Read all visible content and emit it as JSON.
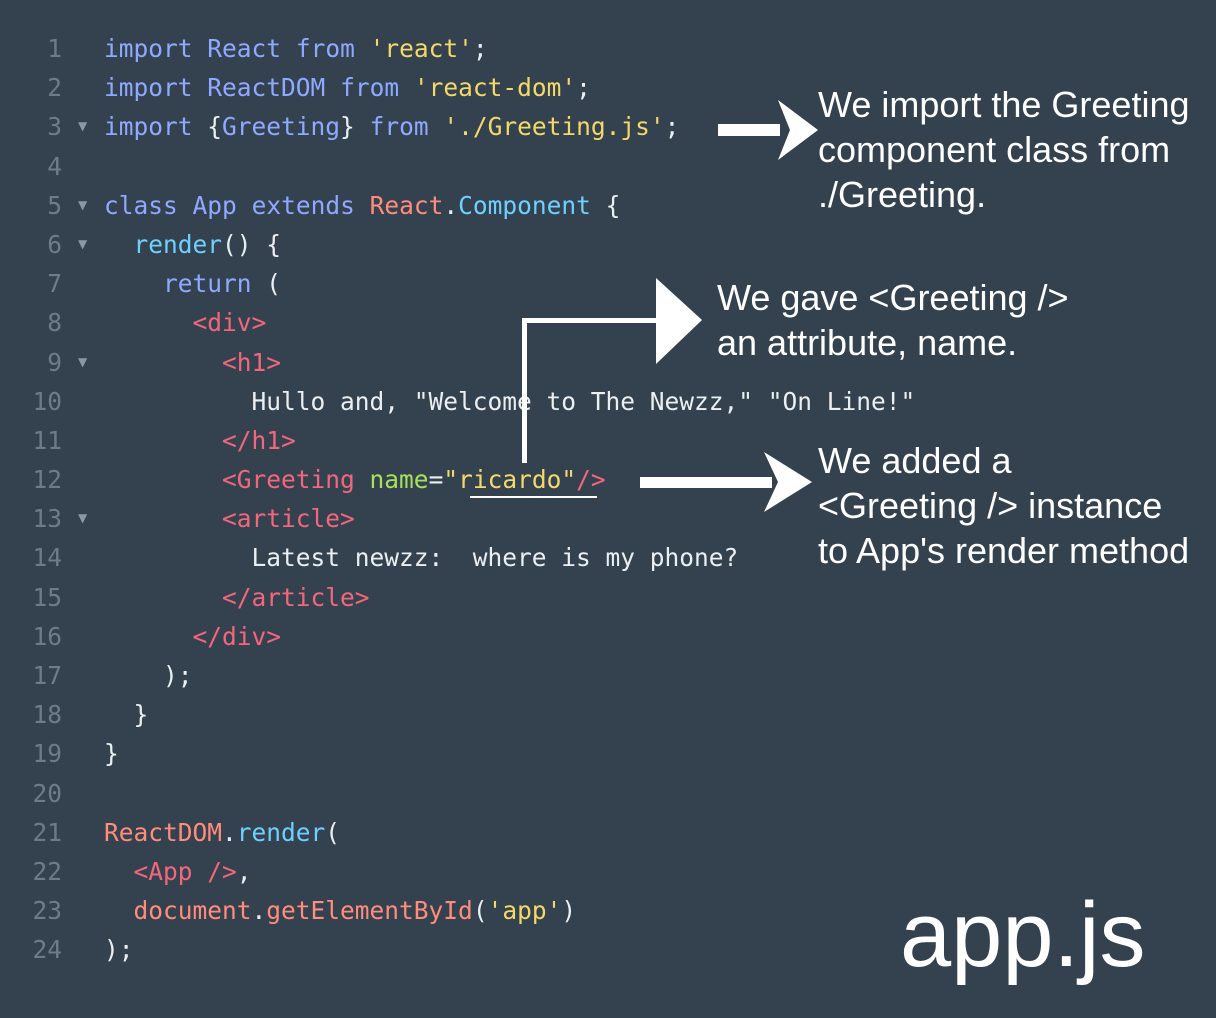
{
  "code_lines": [
    {
      "num": "1",
      "fold": "",
      "tokens": [
        {
          "t": "import",
          "c": "kw"
        },
        {
          "t": " ",
          "c": "text"
        },
        {
          "t": "React",
          "c": "kw"
        },
        {
          "t": " ",
          "c": "text"
        },
        {
          "t": "from",
          "c": "kw"
        },
        {
          "t": " ",
          "c": "text"
        },
        {
          "t": "'react'",
          "c": "str"
        },
        {
          "t": ";",
          "c": "punc"
        }
      ]
    },
    {
      "num": "2",
      "fold": "",
      "tokens": [
        {
          "t": "import",
          "c": "kw"
        },
        {
          "t": " ",
          "c": "text"
        },
        {
          "t": "ReactDOM",
          "c": "kw"
        },
        {
          "t": " ",
          "c": "text"
        },
        {
          "t": "from",
          "c": "kw"
        },
        {
          "t": " ",
          "c": "text"
        },
        {
          "t": "'react-dom'",
          "c": "str"
        },
        {
          "t": ";",
          "c": "punc"
        }
      ]
    },
    {
      "num": "3",
      "fold": "▼",
      "tokens": [
        {
          "t": "import",
          "c": "kw"
        },
        {
          "t": " {",
          "c": "punc"
        },
        {
          "t": "Greeting",
          "c": "kw"
        },
        {
          "t": "} ",
          "c": "punc"
        },
        {
          "t": "from",
          "c": "kw"
        },
        {
          "t": " ",
          "c": "text"
        },
        {
          "t": "'./Greeting.js'",
          "c": "str"
        },
        {
          "t": ";",
          "c": "punc"
        }
      ]
    },
    {
      "num": "4",
      "fold": "",
      "tokens": []
    },
    {
      "num": "5",
      "fold": "▼",
      "tokens": [
        {
          "t": "class",
          "c": "kw"
        },
        {
          "t": " ",
          "c": "text"
        },
        {
          "t": "App",
          "c": "kw"
        },
        {
          "t": " ",
          "c": "text"
        },
        {
          "t": "extends",
          "c": "kw"
        },
        {
          "t": " ",
          "c": "text"
        },
        {
          "t": "React",
          "c": "cls"
        },
        {
          "t": ".",
          "c": "punc"
        },
        {
          "t": "Component",
          "c": "method"
        },
        {
          "t": " {",
          "c": "punc"
        }
      ]
    },
    {
      "num": "6",
      "fold": "▼",
      "tokens": [
        {
          "t": "  ",
          "c": "text"
        },
        {
          "t": "render",
          "c": "method"
        },
        {
          "t": "() {",
          "c": "punc"
        }
      ]
    },
    {
      "num": "7",
      "fold": "",
      "tokens": [
        {
          "t": "    ",
          "c": "text"
        },
        {
          "t": "return",
          "c": "kw"
        },
        {
          "t": " (",
          "c": "punc"
        }
      ]
    },
    {
      "num": "8",
      "fold": "",
      "tokens": [
        {
          "t": "      ",
          "c": "text"
        },
        {
          "t": "<div>",
          "c": "tag"
        }
      ]
    },
    {
      "num": "9",
      "fold": "▼",
      "tokens": [
        {
          "t": "        ",
          "c": "text"
        },
        {
          "t": "<h1>",
          "c": "tag"
        }
      ]
    },
    {
      "num": "10",
      "fold": "",
      "tokens": [
        {
          "t": "          Hullo and, \"Welcome to The Newzz,\" \"On Line!\"",
          "c": "text"
        }
      ]
    },
    {
      "num": "11",
      "fold": "",
      "tokens": [
        {
          "t": "        ",
          "c": "text"
        },
        {
          "t": "</h1>",
          "c": "tag"
        }
      ]
    },
    {
      "num": "12",
      "fold": "",
      "tokens": [
        {
          "t": "        ",
          "c": "text"
        },
        {
          "t": "<Greeting",
          "c": "tag"
        },
        {
          "t": " ",
          "c": "text"
        },
        {
          "t": "name",
          "c": "attr"
        },
        {
          "t": "=",
          "c": "punc"
        },
        {
          "t": "\"ricardo\"",
          "c": "str"
        },
        {
          "t": "/>",
          "c": "tag"
        }
      ]
    },
    {
      "num": "13",
      "fold": "▼",
      "tokens": [
        {
          "t": "        ",
          "c": "text"
        },
        {
          "t": "<article>",
          "c": "tag"
        }
      ]
    },
    {
      "num": "14",
      "fold": "",
      "tokens": [
        {
          "t": "          Latest newzz:  where is my phone?",
          "c": "text"
        }
      ]
    },
    {
      "num": "15",
      "fold": "",
      "tokens": [
        {
          "t": "        ",
          "c": "text"
        },
        {
          "t": "</article>",
          "c": "tag"
        }
      ]
    },
    {
      "num": "16",
      "fold": "",
      "tokens": [
        {
          "t": "      ",
          "c": "text"
        },
        {
          "t": "</div>",
          "c": "tag"
        }
      ]
    },
    {
      "num": "17",
      "fold": "",
      "tokens": [
        {
          "t": "    );",
          "c": "punc"
        }
      ]
    },
    {
      "num": "18",
      "fold": "",
      "tokens": [
        {
          "t": "  }",
          "c": "punc"
        }
      ]
    },
    {
      "num": "19",
      "fold": "",
      "tokens": [
        {
          "t": "}",
          "c": "punc"
        }
      ]
    },
    {
      "num": "20",
      "fold": "",
      "tokens": []
    },
    {
      "num": "21",
      "fold": "",
      "tokens": [
        {
          "t": "ReactDOM",
          "c": "cls"
        },
        {
          "t": ".",
          "c": "punc"
        },
        {
          "t": "render",
          "c": "method"
        },
        {
          "t": "(",
          "c": "punc"
        }
      ]
    },
    {
      "num": "22",
      "fold": "",
      "tokens": [
        {
          "t": "  ",
          "c": "text"
        },
        {
          "t": "<App />",
          "c": "tag"
        },
        {
          "t": ",",
          "c": "punc"
        }
      ]
    },
    {
      "num": "23",
      "fold": "",
      "tokens": [
        {
          "t": "  ",
          "c": "text"
        },
        {
          "t": "document",
          "c": "cls"
        },
        {
          "t": ".",
          "c": "punc"
        },
        {
          "t": "getElementById",
          "c": "cls"
        },
        {
          "t": "(",
          "c": "punc"
        },
        {
          "t": "'app'",
          "c": "str"
        },
        {
          "t": ")",
          "c": "punc"
        }
      ]
    },
    {
      "num": "24",
      "fold": "",
      "tokens": [
        {
          "t": ");",
          "c": "punc"
        }
      ]
    }
  ],
  "annotations": {
    "import_note": "We import the Greeting\ncomponent class from\n./Greeting.",
    "attribute_note": "We gave <Greeting />\nan attribute, name.",
    "instance_note": "We added a\n<Greeting /> instance\nto App's render method"
  },
  "file_label": "app.js",
  "colors": {
    "background": "#34424f",
    "keyword": "#8ea9ff",
    "string": "#f3d86a",
    "class": "#ff8c7c",
    "method": "#6fd0ff",
    "tag": "#f3677c",
    "attribute": "#a8e05c",
    "text": "#eceff1",
    "line_number": "#6d7c88",
    "annotation": "#ffffff"
  }
}
